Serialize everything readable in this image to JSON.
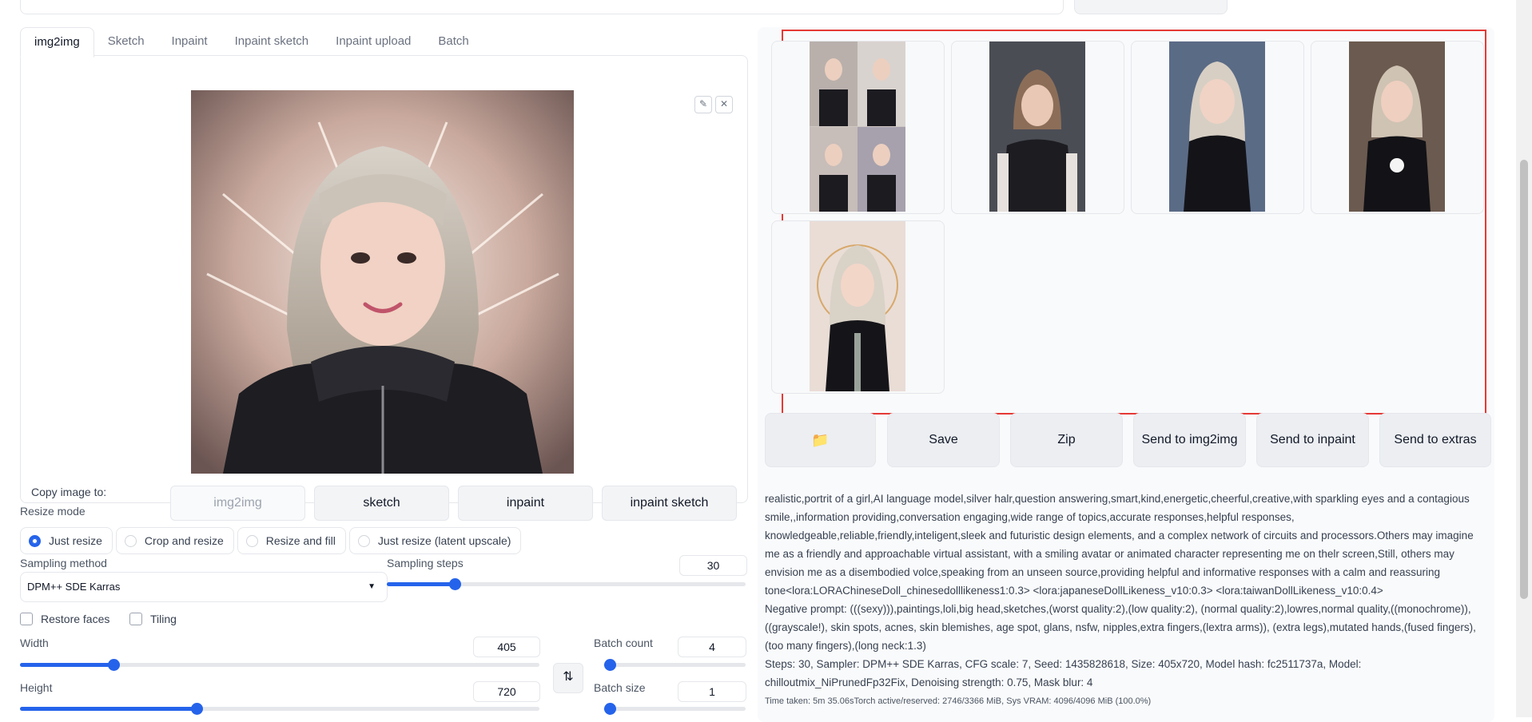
{
  "tabs": [
    "img2img",
    "Sketch",
    "Inpaint",
    "Inpaint sketch",
    "Inpaint upload",
    "Batch"
  ],
  "copy_image": {
    "label": "Copy image to:",
    "buttons": [
      "img2img",
      "sketch",
      "inpaint",
      "inpaint sketch"
    ]
  },
  "resize_mode": {
    "label": "Resize mode",
    "options": [
      "Just resize",
      "Crop and resize",
      "Resize and fill",
      "Just resize (latent upscale)"
    ],
    "selected": "Just resize"
  },
  "sampling": {
    "method_label": "Sampling method",
    "method_value": "DPM++ SDE Karras",
    "steps_label": "Sampling steps",
    "steps_value": "30",
    "steps_fraction": 0.19
  },
  "checkboxes": {
    "restore_faces": "Restore faces",
    "tiling": "Tiling"
  },
  "width": {
    "label": "Width",
    "value": "405",
    "fraction": 0.18
  },
  "height": {
    "label": "Height",
    "value": "720",
    "fraction": 0.34
  },
  "batch_count": {
    "label": "Batch count",
    "value": "4",
    "fraction": 0.0
  },
  "batch_size": {
    "label": "Batch size",
    "value": "1",
    "fraction": 0.0
  },
  "actions": {
    "folder_icon": "folder-icon",
    "save": "Save",
    "zip": "Zip",
    "send_img2img": "Send to img2img",
    "send_inpaint": "Send to inpaint",
    "send_extras": "Send to extras"
  },
  "generation_info": {
    "prompt": "realistic,portrit of a girl,AI language model,silver halr,question answering,smart,kind,energetic,cheerful,creative,with sparkling eyes and a contagious smile,,information providing,conversation engaging,wide range of topics,accurate responses,helpful responses, knowledgeable,reliable,friendly,inteligent,sleek and futuristic design elements, and a complex network of circuits and processors.Others may imagine me as a friendly and approachable virtual assistant, with a smiling avatar or animated character representing me on thelr screen,Still, others may envision me as a disembodied volce,speaking from an unseen source,providing helpful and informative responses with a calm and reassuring tone<lora:LORAChineseDoll_chinesedolllikeness1:0.3> <lora:japaneseDollLikeness_v10:0.3> <lora:taiwanDollLikeness_v10:0.4>",
    "negative": "Negative prompt: (((sexy))),paintings,loli,big head,sketches,(worst quality:2),(low quality:2), (normal quality:2),lowres,normal quality,((monochrome)), ((grayscale!), skin spots, acnes, skin blemishes, age spot, glans, nsfw, nipples,extra fingers,(lextra arms)), (extra legs),mutated hands,(fused fingers),(too many fingers),(long neck:1.3)",
    "params": "Steps: 30, Sampler: DPM++ SDE Karras, CFG scale: 7, Seed: 1435828618, Size: 405x720, Model hash: fc2511737a, Model: chilloutmix_NiPrunedFp32Fix, Denoising strength: 0.75, Mask blur: 4",
    "time": "Time taken: 5m 35.06sTorch active/reserved: 2746/3366 MiB, Sys VRAM: 4096/4096 MiB (100.0%)"
  },
  "colors": {
    "accent": "#2563eb",
    "highlight_frame": "#e53935"
  }
}
